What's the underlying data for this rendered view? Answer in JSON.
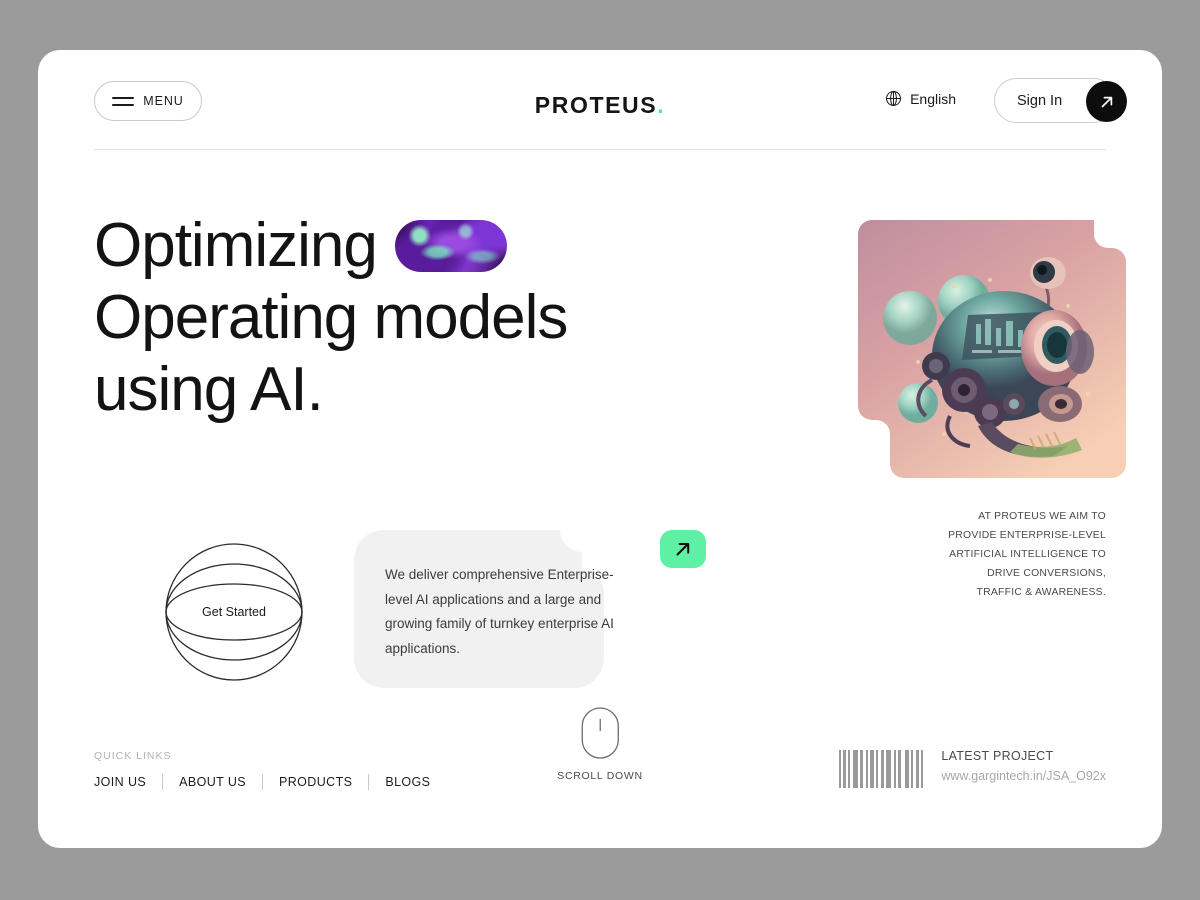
{
  "header": {
    "menu_label": "MENU",
    "menu_icon": "hamburger-icon",
    "logo_text": "PROTEUS",
    "logo_dot": ".",
    "language_label": "English",
    "language_icon": "globe-icon",
    "signin_label": "Sign In",
    "signin_icon": "arrow-up-right-icon"
  },
  "hero": {
    "title_line1": "Optimizing",
    "title_line2": "Operating models",
    "title_line3": "using AI.",
    "inline_graphic": "purple-marble-pill-image",
    "image_alt": "abstract-ai-sphere-render"
  },
  "get_started": {
    "label": "Get Started",
    "icon": "globe-sphere-icon"
  },
  "description": {
    "text": "We deliver comprehensive Enterprise-level AI applications and a large and growing family of turnkey enterprise AI applications.",
    "arrow_icon": "arrow-up-right-icon"
  },
  "about": {
    "line1": "AT PROTEUS WE AIM TO",
    "line2": "PROVIDE ENTERPRISE-LEVEL",
    "line3": "ARTIFICIAL INTELLIGENCE TO",
    "line4": "DRIVE CONVERSIONS,",
    "line5": "TRAFFIC & AWARENESS."
  },
  "footer": {
    "quick_links_title": "QUICK LINKS",
    "links": [
      {
        "label": "JOIN US"
      },
      {
        "label": "ABOUT US"
      },
      {
        "label": "PRODUCTS"
      },
      {
        "label": "BLOGS"
      }
    ],
    "scroll_label": "SCROLL DOWN",
    "scroll_icon": "mouse-icon",
    "project_title": "LATEST PROJECT",
    "project_url": "www.gargintech.in/JSA_O92x",
    "barcode_icon": "barcode-icon"
  },
  "colors": {
    "accent_mint": "#5ef0a5",
    "logo_dot": "#4fe8a4",
    "page_bg": "#ffffff",
    "canvas_bg": "#9b9b9b",
    "card_gray": "#f1f1f1",
    "text_dark": "#131313",
    "text_muted": "#a8a8a8"
  }
}
